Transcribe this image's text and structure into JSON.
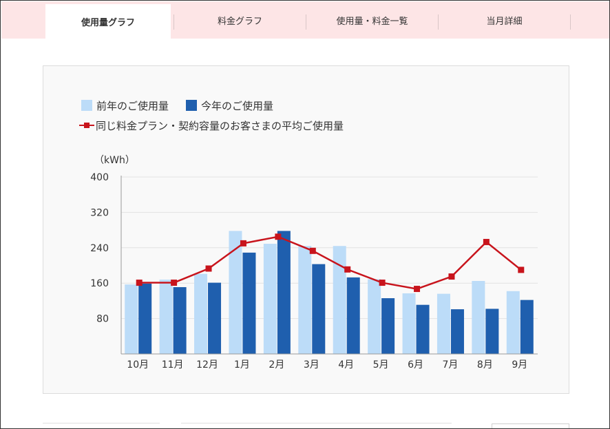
{
  "tabs": [
    {
      "label": "使用量グラフ",
      "active": true
    },
    {
      "label": "料金グラフ",
      "active": false
    },
    {
      "label": "使用量・料金一覧",
      "active": false
    },
    {
      "label": "当月詳細",
      "active": false
    }
  ],
  "colors": {
    "tab_bar_bg": "#fde5e6",
    "prev_year": "#bcdcf8",
    "this_year": "#1f5fae",
    "average_line": "#c8141c"
  },
  "chart_data": {
    "type": "bar",
    "unit_label": "（kWh）",
    "categories": [
      "10月",
      "11月",
      "12月",
      "1月",
      "2月",
      "3月",
      "4月",
      "5月",
      "6月",
      "7月",
      "8月",
      "9月"
    ],
    "series": [
      {
        "name": "前年のご使用量",
        "kind": "bar",
        "values": [
          157,
          168,
          181,
          278,
          249,
          244,
          244,
          169,
          137,
          136,
          165,
          142
        ]
      },
      {
        "name": "今年のご使用量",
        "kind": "bar",
        "values": [
          159,
          151,
          161,
          229,
          278,
          203,
          173,
          126,
          111,
          101,
          102,
          122
        ]
      },
      {
        "name": "同じ料金プラン・契約容量のお客さまの平均ご使用量",
        "kind": "line",
        "values": [
          161,
          161,
          193,
          250,
          265,
          233,
          191,
          161,
          147,
          175,
          253,
          190
        ]
      }
    ],
    "ylim": [
      0,
      400
    ],
    "yticks": [
      80,
      160,
      240,
      320,
      400
    ],
    "grid": true,
    "legend_position": "top-left"
  }
}
